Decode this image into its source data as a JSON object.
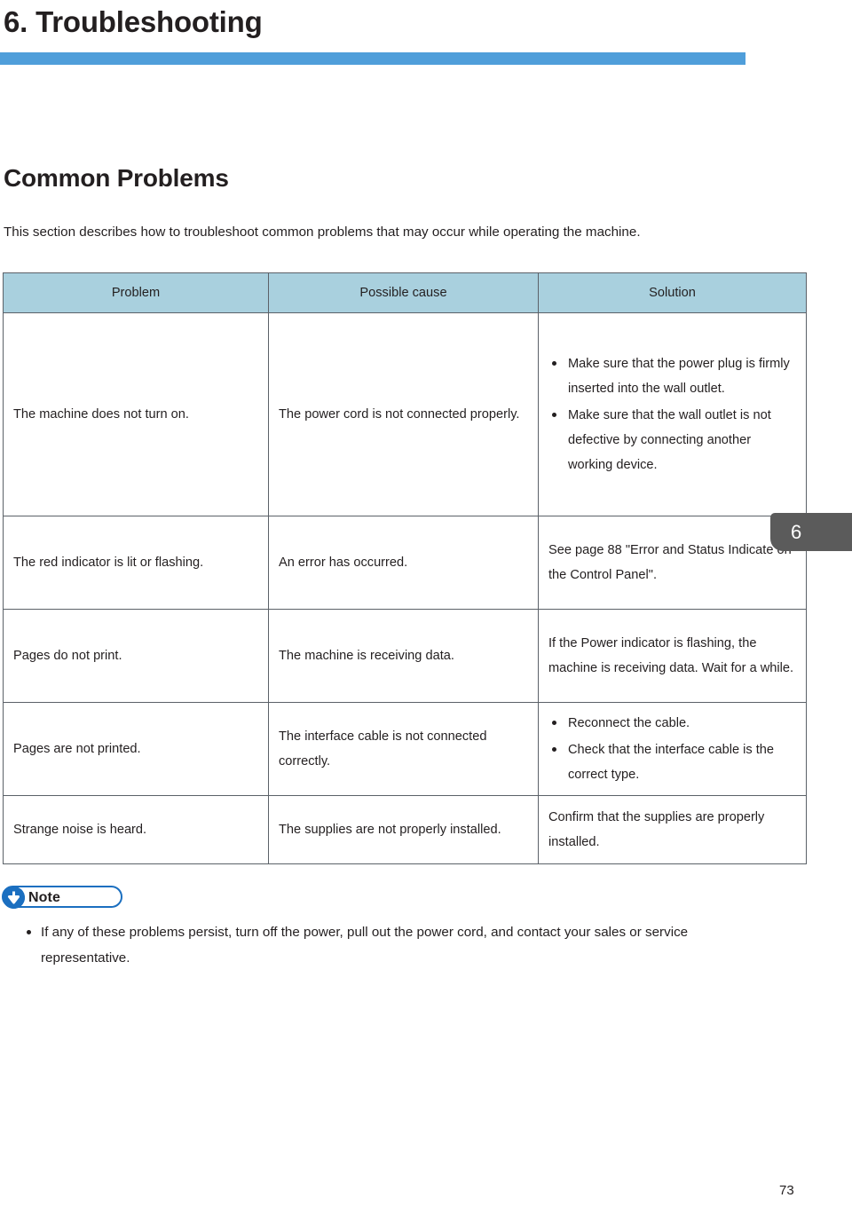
{
  "chapter": {
    "title": "6. Troubleshooting",
    "rule_color": "#4f9eda",
    "tab_number": "6",
    "tab_color": "#5b5b5b"
  },
  "section": {
    "heading": "Common Problems",
    "intro": "This section describes how to troubleshoot common problems that may occur while operating the machine."
  },
  "table": {
    "header_bg": "#a9d0de",
    "columns": [
      "Problem",
      "Possible cause",
      "Solution"
    ],
    "rows": [
      {
        "problem": "The machine does not turn on.",
        "cause": "The power cord is not connected properly.",
        "solution_items": [
          "Make sure that the power plug is firmly inserted into the wall outlet.",
          "Make sure that the wall outlet is not defective by connecting another working device."
        ]
      },
      {
        "problem": "The red indicator is lit or flashing.",
        "cause": "An error has occurred.",
        "solution": "See page 88 \"Error and Status Indicate on the Control Panel\"."
      },
      {
        "problem": "Pages do not print.",
        "cause": "The machine is receiving data.",
        "solution": "If the Power indicator is flashing, the machine is receiving data. Wait for a while."
      },
      {
        "problem": "Pages are not printed.",
        "cause": "The interface cable is not connected correctly.",
        "solution_items": [
          "Reconnect the cable.",
          "Check that the interface cable is the correct type."
        ]
      },
      {
        "problem": "Strange noise is heard.",
        "cause": "The supplies are not properly installed.",
        "solution": "Confirm that the supplies are properly installed."
      }
    ]
  },
  "note": {
    "label": "Note",
    "icon": "down-arrow-circle-icon",
    "accent_color": "#1b6fc0",
    "items": [
      "If any of these problems persist, turn off the power, pull out the power cord, and contact your sales or service representative."
    ]
  },
  "footer": {
    "page_number": "73"
  }
}
